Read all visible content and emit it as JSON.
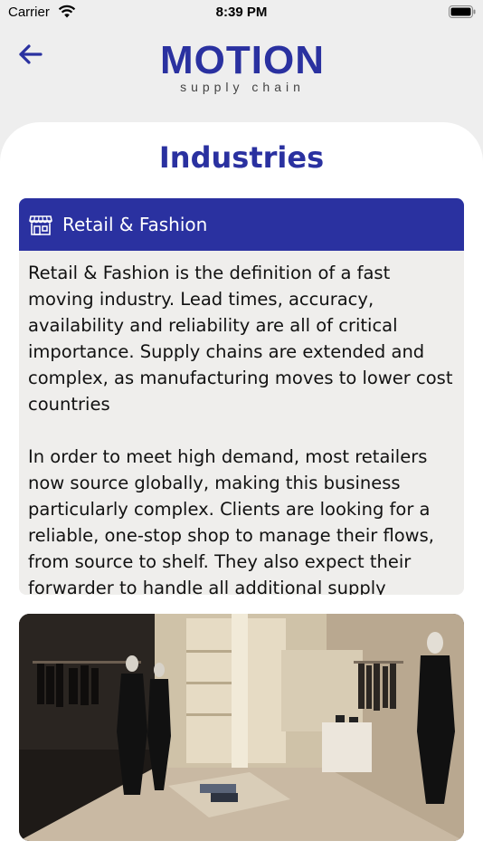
{
  "status_bar": {
    "carrier": "Carrier",
    "time": "8:39 PM"
  },
  "header": {
    "back_icon": "arrow-left-icon",
    "logo_word": "MOTION",
    "logo_tagline": "supply chain"
  },
  "page": {
    "title": "Industries"
  },
  "section": {
    "icon": "storefront-icon",
    "title": "Retail & Fashion",
    "paragraphs": [
      "Retail & Fashion is the definition of a fast moving industry. Lead times, accuracy, availability and reliability are all of critical importance. Supply chains are extended and complex, as manufacturing moves to lower cost countries",
      "In order to meet high demand, most retailers now source globally, making this business particularly complex. Clients are looking for a reliable, one-stop shop to manage their flows, from source to shelf. They also expect their forwarder to handle all additional supply"
    ]
  },
  "colors": {
    "brand_blue": "#2a31a0",
    "page_bg": "#eeeeee",
    "section_bg": "#efeeec"
  }
}
